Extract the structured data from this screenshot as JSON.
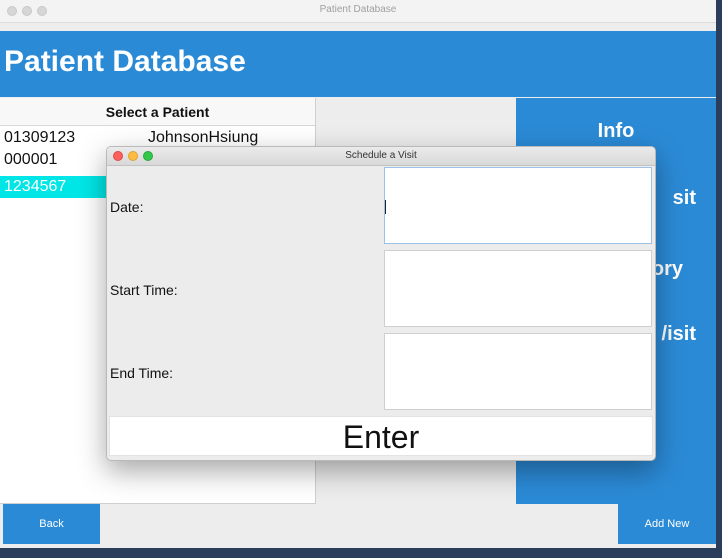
{
  "window": {
    "title": "Patient Database"
  },
  "header": {
    "title": "Patient Database"
  },
  "patient_list": {
    "header": "Select a Patient",
    "rows": [
      {
        "id": "01309123",
        "name": "JohnsonHsiung"
      },
      {
        "id": "000001",
        "name": ""
      },
      {
        "id": "1234567",
        "name": ""
      }
    ],
    "selected_index": 2
  },
  "side_menu": {
    "items": [
      {
        "label": "Info"
      },
      {
        "label": "sit"
      },
      {
        "label": "ory"
      },
      {
        "label": "/isit"
      }
    ]
  },
  "buttons": {
    "back": "Back",
    "add_new": "Add New"
  },
  "dialog": {
    "title": "Schedule a Visit",
    "fields": [
      {
        "label": "Date:",
        "value": ""
      },
      {
        "label": "Start Time:",
        "value": ""
      },
      {
        "label": "End Time:",
        "value": ""
      }
    ],
    "enter_label": "Enter"
  },
  "colors": {
    "accent": "#2b8ad6",
    "selected_row": "#00e6e6",
    "traffic_red": "#fc605c",
    "traffic_yellow": "#fdbc40",
    "traffic_green": "#34c84a"
  }
}
